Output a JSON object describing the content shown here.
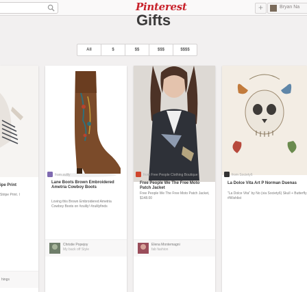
{
  "header": {
    "logo": "Pinterest",
    "plus": "+",
    "user_name": "Bryan Na"
  },
  "page": {
    "title": "Gifts"
  },
  "price_filters": [
    "All",
    "$",
    "$$",
    "$$$",
    "$$$$"
  ],
  "pins": [
    {
      "source": "",
      "title": "ipe Print",
      "comment": "Stripe Print. I",
      "pinner": "",
      "board": "hings"
    },
    {
      "source": "from zulily",
      "title": "Lane Boots Brown Embroidered Ametria Cowboy Boots",
      "comment": "Loving this Brown Embroidered Ametria Cowboy Boots on #zulily! #zulilyfinds",
      "pinner": "Christie Popejoy",
      "board": "My back off Style"
    },
    {
      "source": "from Free People Clothing Boutique",
      "title": "Free People We The Free Moto Patch Jacket",
      "comment": "Free People We The Free Moto Patch Jacket, $148.00",
      "pinner": "Elena Montemagni",
      "board": "fab fashion"
    },
    {
      "source": "from Society6",
      "title": "La Dolce Vita Art P Norman Duenas",
      "comment": "\"La Dolce Vita\" by No (via Society6) Skull + Butterfly #Wishlist",
      "pinner": "",
      "board": ""
    }
  ],
  "colors": {
    "brand": "#c8232c",
    "background": "#f2f0f0"
  }
}
